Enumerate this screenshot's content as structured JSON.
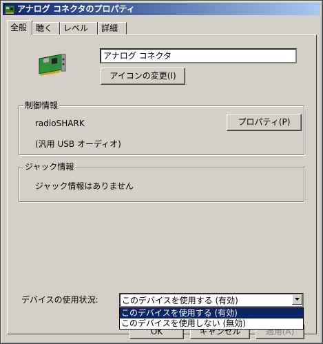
{
  "window": {
    "title": "アナログ コネクタのプロパティ"
  },
  "tabs": [
    {
      "label": "全般",
      "active": true
    },
    {
      "label": "聴く",
      "active": false
    },
    {
      "label": "レベル",
      "active": false
    },
    {
      "label": "詳細",
      "active": false
    }
  ],
  "general": {
    "name_value": "アナログ コネクタ",
    "change_icon_label": "アイコンの変更(I)"
  },
  "controller": {
    "group_title": "制御情報",
    "device_name": "radioSHARK",
    "device_type": "(汎用 USB オーディオ)",
    "properties_label": "プロパティ(P)"
  },
  "jack": {
    "group_title": "ジャック情報",
    "info_text": "ジャック情報はありません"
  },
  "usage": {
    "label": "デバイスの使用状況:",
    "selected": "このデバイスを使用する (有効)",
    "options": [
      "このデバイスを使用する (有効)",
      "このデバイスを使用しない (無効)"
    ]
  },
  "footer": {
    "ok_label": "OK",
    "cancel_label": "キャンセル",
    "apply_label": "適用(A)"
  },
  "colors": {
    "titlebar_start": "#0a246a",
    "titlebar_end": "#a6caf0",
    "face": "#d4d0c8",
    "selection": "#0a246a"
  }
}
